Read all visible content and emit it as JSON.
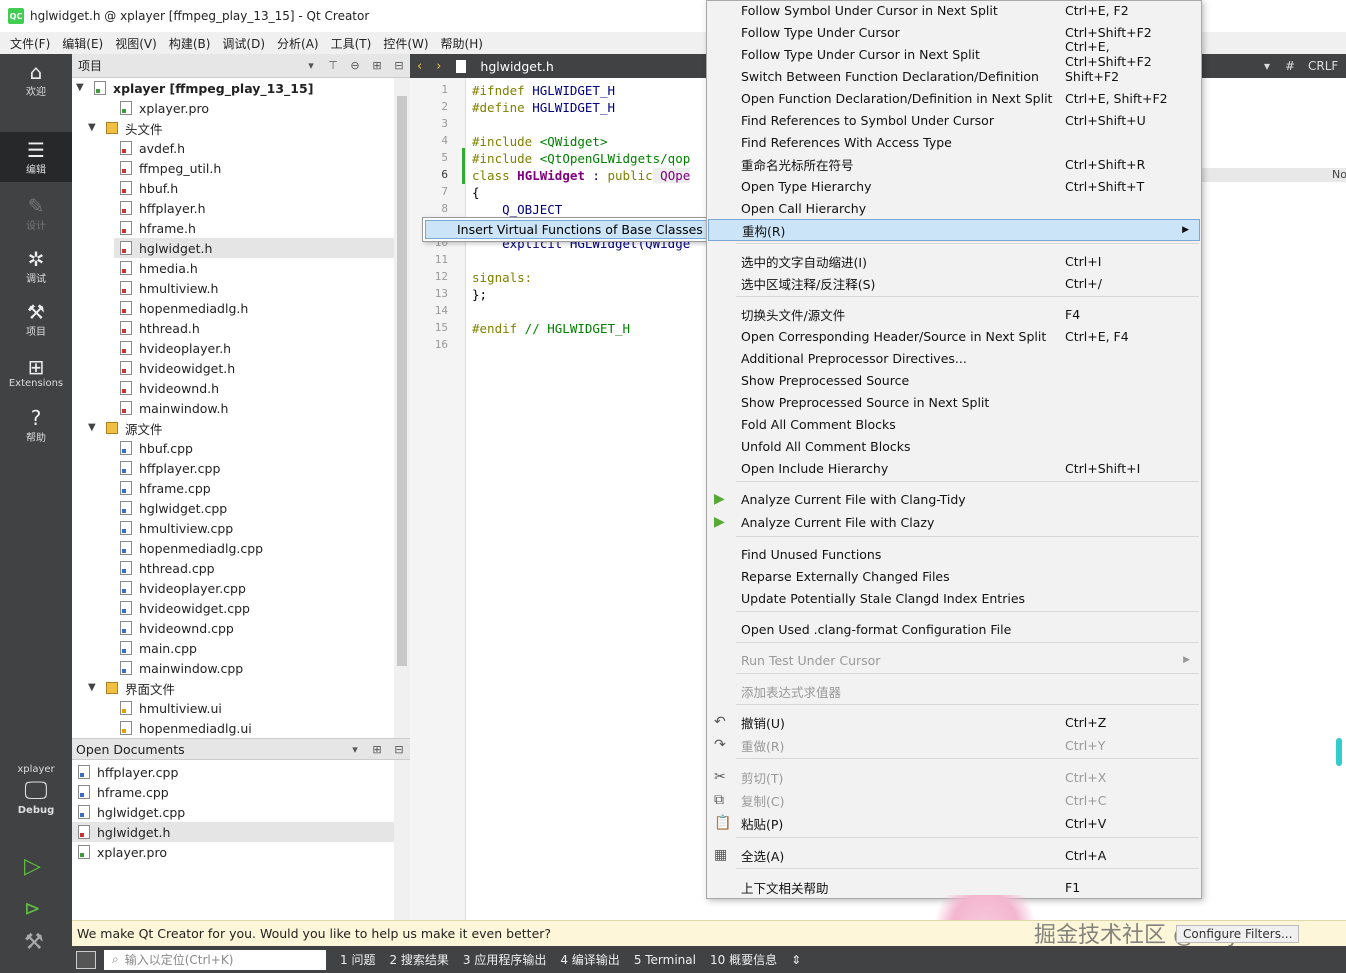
{
  "window": {
    "title": "hglwidget.h @ xplayer [ffmpeg_play_13_15] - Qt Creator",
    "app_icon": "QC"
  },
  "menubar": [
    "文件(F)",
    "编辑(E)",
    "视图(V)",
    "构建(B)",
    "调试(D)",
    "分析(A)",
    "工具(T)",
    "控件(W)",
    "帮助(H)"
  ],
  "modes": [
    {
      "label": "欢迎",
      "icon": "home-icon"
    },
    {
      "label": "编辑",
      "icon": "edit-icon"
    },
    {
      "label": "设计",
      "icon": "design-icon"
    },
    {
      "label": "调试",
      "icon": "debug-icon"
    },
    {
      "label": "项目",
      "icon": "wrench-icon"
    },
    {
      "label": "Extensions",
      "icon": "extensions-icon"
    },
    {
      "label": "帮助",
      "icon": "help-icon"
    }
  ],
  "target": {
    "name": "xplayer",
    "config": "Debug"
  },
  "project_panel": {
    "title": "项目",
    "project": "xplayer [ffmpeg_play_13_15]",
    "pro_file": "xplayer.pro",
    "headers_label": "头文件",
    "headers": [
      "avdef.h",
      "ffmpeg_util.h",
      "hbuf.h",
      "hffplayer.h",
      "hframe.h",
      "hglwidget.h",
      "hmedia.h",
      "hmultiview.h",
      "hopenmediadlg.h",
      "hthread.h",
      "hvideoplayer.h",
      "hvideowidget.h",
      "hvideownd.h",
      "mainwindow.h"
    ],
    "sources_label": "源文件",
    "sources": [
      "hbuf.cpp",
      "hffplayer.cpp",
      "hframe.cpp",
      "hglwidget.cpp",
      "hmultiview.cpp",
      "hopenmediadlg.cpp",
      "hthread.cpp",
      "hvideoplayer.cpp",
      "hvideowidget.cpp",
      "hvideownd.cpp",
      "main.cpp",
      "mainwindow.cpp"
    ],
    "forms_label": "界面文件",
    "forms": [
      "hmultiview.ui",
      "hopenmediadlg.ui"
    ],
    "selected": "hglwidget.h"
  },
  "open_documents": {
    "title": "Open Documents",
    "items": [
      "hffplayer.cpp",
      "hframe.cpp",
      "hglwidget.cpp",
      "hglwidget.h",
      "xplayer.pro"
    ],
    "selected": "hglwidget.h"
  },
  "editor": {
    "filename": "hglwidget.h",
    "line_ending": "CRLF",
    "hash": "#",
    "right_edge_text": "No",
    "current_line": "6",
    "line_numbers": [
      "1",
      "2",
      "3",
      "4",
      "5",
      "6",
      "7",
      "8",
      "10",
      "11",
      "12",
      "13",
      "14",
      "15",
      "16"
    ],
    "code": {
      "l1_kw": "#ifndef",
      "l1_rest": " HGLWIDGET_H",
      "l2_kw": "#define",
      "l2_rest": " HGLWIDGET_H",
      "l4_kw": "#include",
      "l4_rest": " <QWidget>",
      "l5_kw": "#include",
      "l5_rest": " <QtOpenGLWidgets/qop",
      "l6_kw": "class",
      "l6_name": " HGLWidget",
      "l6_mid": " : ",
      "l6_kw2": "public",
      "l6_rest": " QOpe",
      "l7": "{",
      "l8": "    Q_OBJECT",
      "l10": "    explicit HGLWidget(QWidge",
      "l12": "signals:",
      "l13": "};",
      "l15_kw": "#endif",
      "l15_rest": " // HGLWIDGET_H"
    }
  },
  "tooltip": "Insert Virtual Functions of Base Classes",
  "context_menu": [
    {
      "label": "Follow Symbol Under Cursor in Next Split",
      "shortcut": "Ctrl+E, F2"
    },
    {
      "label": "Follow Type Under Cursor",
      "shortcut": "Ctrl+Shift+F2"
    },
    {
      "label": "Follow Type Under Cursor in Next Split",
      "shortcut": "Ctrl+E, Ctrl+Shift+F2"
    },
    {
      "label": "Switch Between Function Declaration/Definition",
      "shortcut": "Shift+F2"
    },
    {
      "label": "Open Function Declaration/Definition in Next Split",
      "shortcut": "Ctrl+E, Shift+F2"
    },
    {
      "label": "Find References to Symbol Under Cursor",
      "shortcut": "Ctrl+Shift+U"
    },
    {
      "label": "Find References With Access Type",
      "shortcut": ""
    },
    {
      "label": "重命名光标所在符号",
      "shortcut": "Ctrl+Shift+R"
    },
    {
      "label": "Open Type Hierarchy",
      "shortcut": "Ctrl+Shift+T"
    },
    {
      "label": "Open Call Hierarchy",
      "shortcut": ""
    },
    {
      "label": "重构(R)",
      "shortcut": ""
    },
    {
      "label": "选中的文字自动缩进(I)",
      "shortcut": "Ctrl+I"
    },
    {
      "label": "选中区域注释/反注释(S)",
      "shortcut": "Ctrl+/"
    },
    {
      "label": "切换头文件/源文件",
      "shortcut": "F4"
    },
    {
      "label": "Open Corresponding Header/Source in Next Split",
      "shortcut": "Ctrl+E, F4"
    },
    {
      "label": "Additional Preprocessor Directives...",
      "shortcut": ""
    },
    {
      "label": "Show Preprocessed Source",
      "shortcut": ""
    },
    {
      "label": "Show Preprocessed Source in Next Split",
      "shortcut": ""
    },
    {
      "label": "Fold All Comment Blocks",
      "shortcut": ""
    },
    {
      "label": "Unfold All Comment Blocks",
      "shortcut": ""
    },
    {
      "label": "Open Include Hierarchy",
      "shortcut": "Ctrl+Shift+I"
    },
    {
      "label": "Analyze Current File with Clang-Tidy",
      "shortcut": ""
    },
    {
      "label": "Analyze Current File with Clazy",
      "shortcut": ""
    },
    {
      "label": "Find Unused Functions",
      "shortcut": ""
    },
    {
      "label": "Reparse Externally Changed Files",
      "shortcut": ""
    },
    {
      "label": "Update Potentially Stale Clangd Index Entries",
      "shortcut": ""
    },
    {
      "label": "Open Used .clang-format Configuration File",
      "shortcut": ""
    },
    {
      "label": "Run Test Under Cursor",
      "shortcut": ""
    },
    {
      "label": "添加表达式求值器",
      "shortcut": ""
    },
    {
      "label": "撤销(U)",
      "shortcut": "Ctrl+Z"
    },
    {
      "label": "重做(R)",
      "shortcut": "Ctrl+Y"
    },
    {
      "label": "剪切(T)",
      "shortcut": "Ctrl+X"
    },
    {
      "label": "复制(C)",
      "shortcut": "Ctrl+C"
    },
    {
      "label": "粘贴(P)",
      "shortcut": "Ctrl+V"
    },
    {
      "label": "全选(A)",
      "shortcut": "Ctrl+A"
    },
    {
      "label": "上下文相关帮助",
      "shortcut": "F1"
    }
  ],
  "notification": {
    "text": "We make Qt Creator for you. Would you like to help us make it even better?",
    "watermark": "掘金技术社区 @ xcyxiner",
    "button": "Configure Filters..."
  },
  "statusbar": {
    "locator_placeholder": "输入以定位(Ctrl+K)",
    "panes": [
      "1  问题",
      "2  搜索结果",
      "3  应用程序输出",
      "4  编译输出",
      "5  Terminal",
      "10  概要信息"
    ]
  }
}
